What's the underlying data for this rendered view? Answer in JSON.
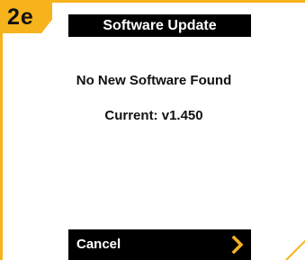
{
  "step": {
    "label": "2e"
  },
  "screen": {
    "title": "Software Update",
    "message": "No New Software Found",
    "current_version": "Current: v1.450"
  },
  "softkey": {
    "label": "Cancel",
    "icon": "chevron-right-icon"
  },
  "colors": {
    "accent": "#f6b31c",
    "bar": "#000000",
    "text": "#111111",
    "bar_text": "#ffffff"
  }
}
